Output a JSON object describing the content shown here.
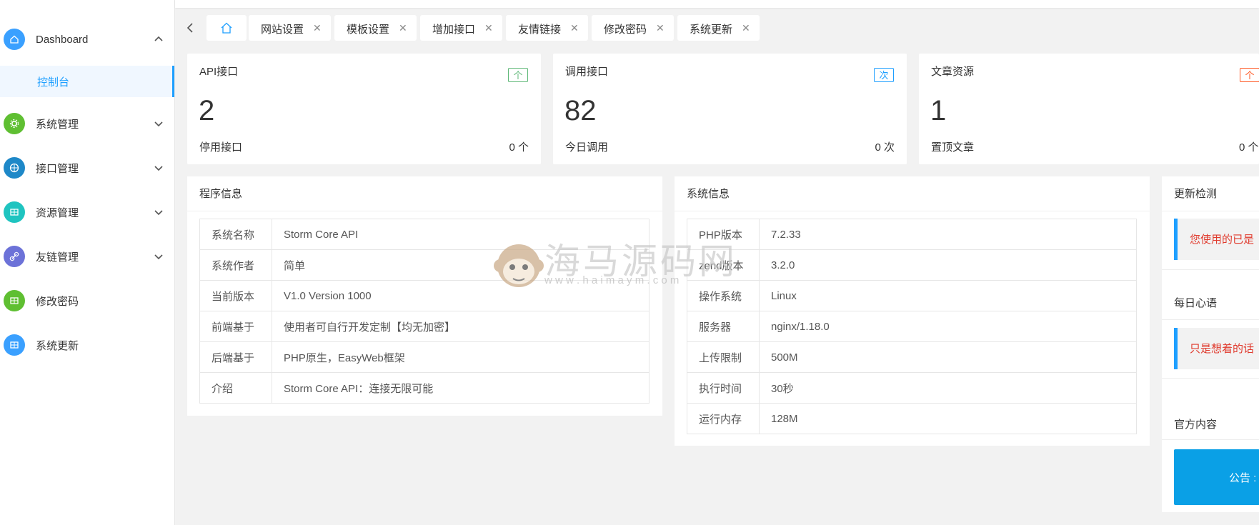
{
  "sidebar": {
    "dashboard": {
      "label": "Dashboard",
      "color": "#3aa0ff",
      "icon": "home-icon"
    },
    "sub_item": {
      "label": "控制台"
    },
    "items": [
      {
        "label": "系统管理",
        "color": "#5fbf32",
        "icon": "gear-icon"
      },
      {
        "label": "接口管理",
        "color": "#1e88c8",
        "icon": "globe-icon"
      },
      {
        "label": "资源管理",
        "color": "#1fc4c0",
        "icon": "grid-icon"
      },
      {
        "label": "友链管理",
        "color": "#6c72d8",
        "icon": "link-icon"
      },
      {
        "label": "修改密码",
        "color": "#5fbf32",
        "icon": "grid-icon"
      },
      {
        "label": "系统更新",
        "color": "#3aa0ff",
        "icon": "grid-icon"
      }
    ]
  },
  "tabs": [
    {
      "label": "网站设置"
    },
    {
      "label": "模板设置"
    },
    {
      "label": "增加接口"
    },
    {
      "label": "友情链接"
    },
    {
      "label": "修改密码"
    },
    {
      "label": "系统更新"
    }
  ],
  "stats": [
    {
      "title": "API接口",
      "badge": "个",
      "badge_color": "#5fb878",
      "number": "2",
      "sub_label": "停用接口",
      "sub_value": "0 个"
    },
    {
      "title": "调用接口",
      "badge": "次",
      "badge_color": "#1e9fff",
      "number": "82",
      "sub_label": "今日调用",
      "sub_value": "0 次"
    },
    {
      "title": "文章资源",
      "badge": "个",
      "badge_color": "#ff5722",
      "number": "1",
      "sub_label": "置顶文章",
      "sub_value": "0 个"
    }
  ],
  "program_info": {
    "title": "程序信息",
    "rows": [
      {
        "k": "系统名称",
        "v": "Storm Core API"
      },
      {
        "k": "系统作者",
        "v": "简单"
      },
      {
        "k": "当前版本",
        "v": "V1.0 Version 1000"
      },
      {
        "k": "前端基于",
        "v": "使用者可自行开发定制【均无加密】"
      },
      {
        "k": "后端基于",
        "v": "PHP原生，EasyWeb框架"
      },
      {
        "k": "介绍",
        "v": "Storm Core API：连接无限可能"
      }
    ]
  },
  "system_info": {
    "title": "系统信息",
    "rows": [
      {
        "k": "PHP版本",
        "v": "7.2.33"
      },
      {
        "k": "zend版本",
        "v": "3.2.0"
      },
      {
        "k": "操作系统",
        "v": "Linux"
      },
      {
        "k": "服务器",
        "v": "nginx/1.18.0"
      },
      {
        "k": "上传限制",
        "v": "500M"
      },
      {
        "k": "执行时间",
        "v": "30秒"
      },
      {
        "k": "运行内存",
        "v": "128M"
      }
    ]
  },
  "update_panel": {
    "title": "更新检测",
    "notice": "您使用的已是",
    "quote_title": "每日心语",
    "quote": "只是想着的话",
    "official_title": "官方内容",
    "announcement": "公告 : 系"
  },
  "watermark": {
    "text": "海马源码网",
    "url": "w w w . h a i m a y m . c o m"
  }
}
